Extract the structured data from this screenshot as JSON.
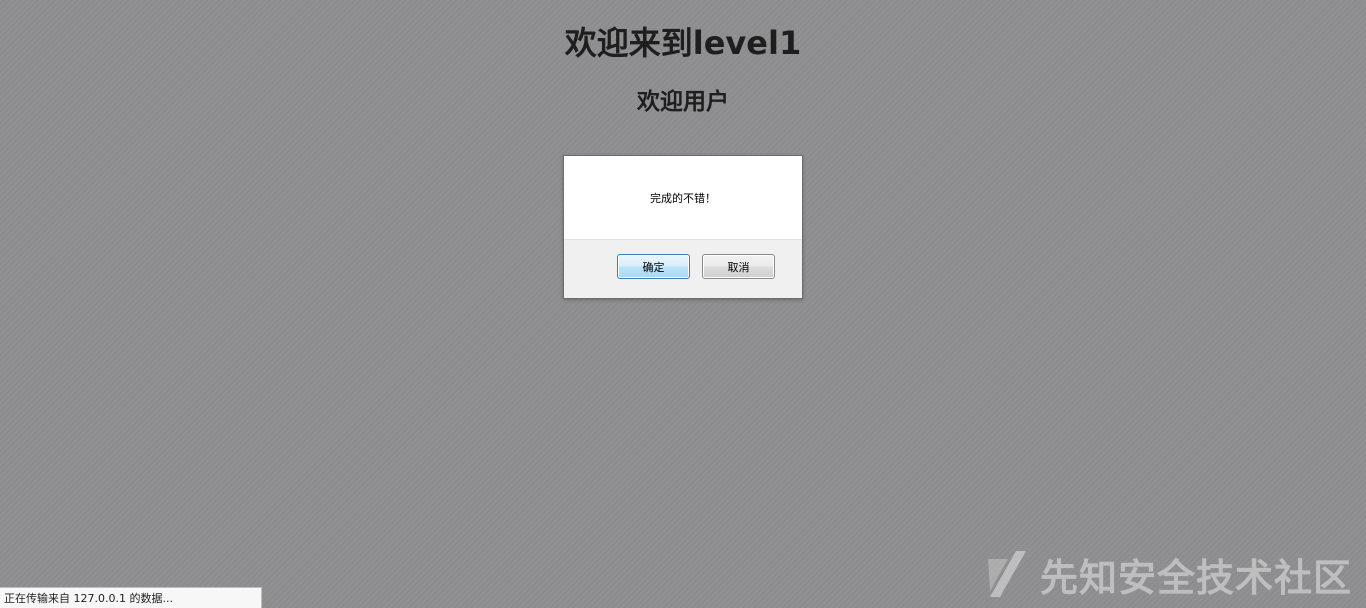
{
  "page": {
    "heading": "欢迎来到level1",
    "subheading": "欢迎用户"
  },
  "dialog": {
    "message": "完成的不错！",
    "ok_label": "确定",
    "cancel_label": "取消"
  },
  "statusbar": {
    "text": "正在传输来自 127.0.0.1 的数据..."
  },
  "watermark": {
    "text": "先知安全技术社区"
  },
  "colors": {
    "overlay_background": "#8f8f91",
    "dialog_background": "#ffffff",
    "dialog_footer": "#f0f0f0",
    "ok_button_border": "#3c7fb1"
  }
}
